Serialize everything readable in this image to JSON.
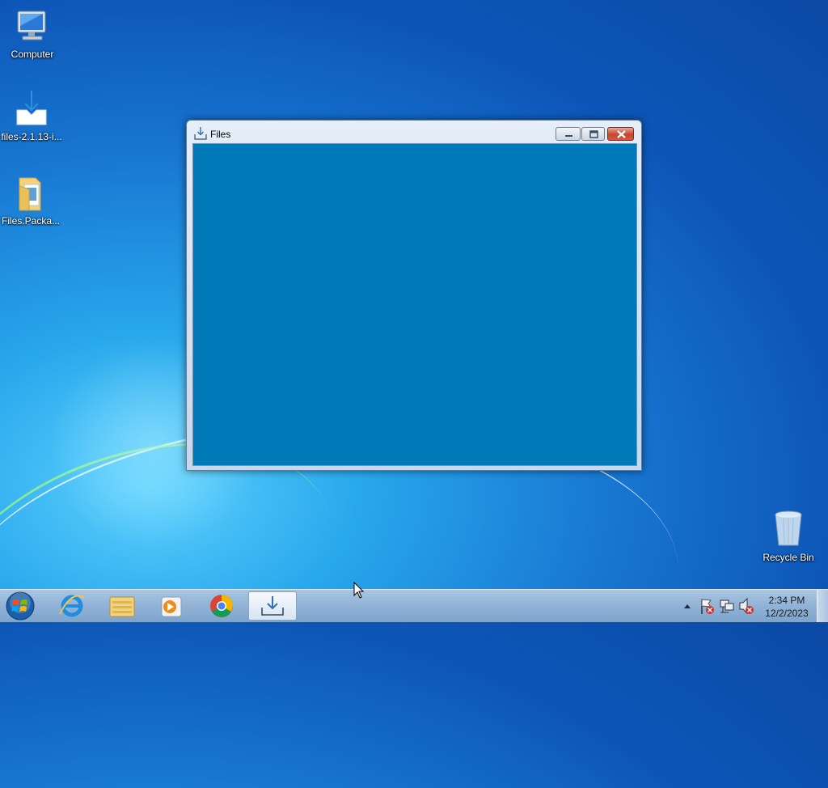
{
  "desktop": {
    "icons": [
      {
        "label": "Computer",
        "icon": "computer-icon"
      },
      {
        "label": "files-2.1.13-i...",
        "icon": "installer-download-icon"
      },
      {
        "label": "Files.Packa...",
        "icon": "folder-icon"
      },
      {
        "label": "Recycle Bin",
        "icon": "recycle-bin-icon"
      }
    ]
  },
  "window": {
    "title": "Files",
    "icon": "download-icon",
    "client_color": "#0079b9",
    "buttons": {
      "minimize": "minimize-icon",
      "maximize": "maximize-icon",
      "close": "close-icon"
    }
  },
  "taskbar": {
    "start": "windows-start-icon",
    "pinned": [
      {
        "name": "internet-explorer-icon"
      },
      {
        "name": "file-explorer-icon"
      },
      {
        "name": "media-player-icon"
      },
      {
        "name": "chrome-icon"
      },
      {
        "name": "files-app-icon",
        "active": true
      }
    ],
    "tray": {
      "icons": [
        "show-hidden-icons-chevron",
        "action-center-flag-icon",
        "network-icon",
        "volume-muted-icon"
      ],
      "time": "2:34 PM",
      "date": "12/2/2023"
    }
  },
  "colors": {
    "accent": "#0079b9",
    "taskbar": "#93b4d8",
    "close_button": "#c8452e"
  }
}
